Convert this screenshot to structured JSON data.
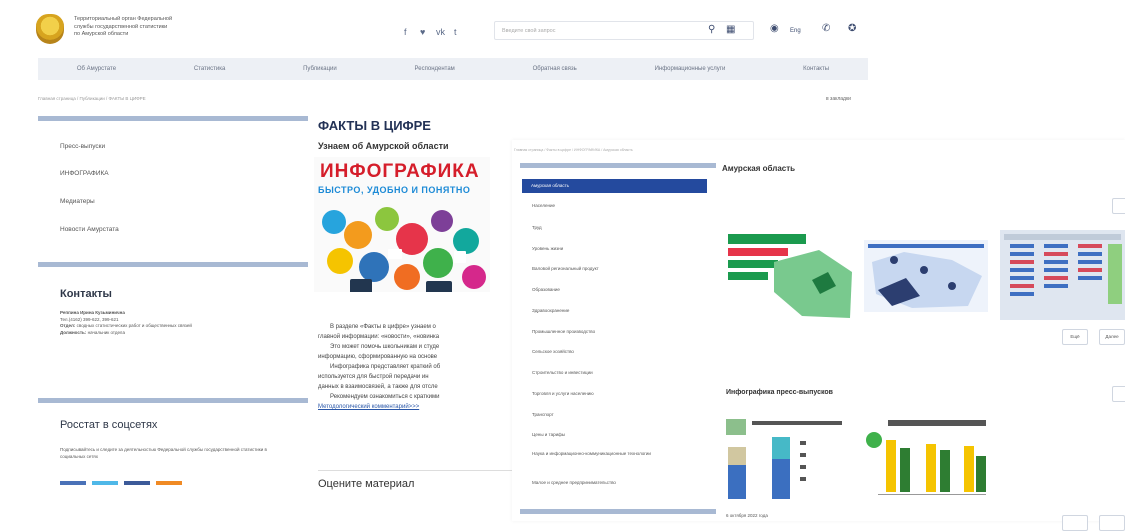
{
  "header": {
    "org_lines": [
      "Территориальный орган Федеральной",
      "службы государственной статистики",
      "по Амурской области"
    ],
    "social_icons": [
      "f",
      "♥",
      "vk",
      "t"
    ],
    "search_placeholder": "Введите свой запрос",
    "lang": "Eng"
  },
  "menu": {
    "items": [
      "Об Амурстате",
      "Статистика",
      "Публикации",
      "Респондентам",
      "Обратная связь",
      "Информационные услуги",
      "Контакты"
    ]
  },
  "breadcrumb": "Главная страница / Публикации / ФАКТЫ В ЦИФРЕ",
  "in_section": "в закладки",
  "sidebar": {
    "items": [
      "Пресс-выпуски",
      "ИНФОГРАФИКА",
      "Медиатеры",
      "Новости Амурстата"
    ],
    "contacts_title": "Контакты",
    "contacts": {
      "name": "Реппина Ирина Кузьминична",
      "phone": "Тел.(4162) 399-622, 399-621",
      "dept_label": "Отдел:",
      "dept": "сводных статистических работ и общественных связей",
      "position_label": "Должность:",
      "position": "начальник отдела"
    },
    "social_title": "Росстат в соцсетях",
    "social_text": "Подписывайтесь и следите за деятельностью Федеральной службы государственной статистики в социальных сетях"
  },
  "main": {
    "title": "ФАКТЫ В ЦИФРЕ",
    "subtitle": "Узнаем об Амурской области",
    "infographic_title": "ИНФОГРАФИКА",
    "infographic_sub": "БЫСТРО, УДОБНО И ПОНЯТНО",
    "paragraphs": [
      "В разделе «Факты в цифре» узнаем о",
      "главной информации: «новости», «новинка",
      "Это может помочь школьникам и студе",
      "информацию, сформированную на основе",
      "Инфографика представляет краткий об",
      "используется для быстрой передачи ин",
      "данных в взаимосвязей, а также для отсле",
      "Рекомендуем ознакомиться с краткими"
    ],
    "link": "Методологический комментарий>>>",
    "rate_label": "Оцените материал"
  },
  "overlay": {
    "crumbs": "Главная страница / Факты в цифре / ИНФОГРАФИКА / Амурская область",
    "active_item": "Амурская область",
    "items": [
      "Население",
      "Труд",
      "Уровень жизни",
      "Валовой региональный продукт",
      "Образование",
      "Здравоохранение",
      "Промышленное производство",
      "Сельское хозяйство",
      "Строительство и инвестиции",
      "Торговля и услуги населению",
      "Транспорт",
      "Цены и тарифы",
      "Наука и информационно-коммуникационные технологии",
      "Малое и среднее предпринимательство"
    ],
    "region_title": "Амурская область",
    "btn_more": "Ещё",
    "btn_close": "Далее",
    "press_title": "Инфографика пресс-выпусков",
    "date": "6 октября 2022 года"
  }
}
